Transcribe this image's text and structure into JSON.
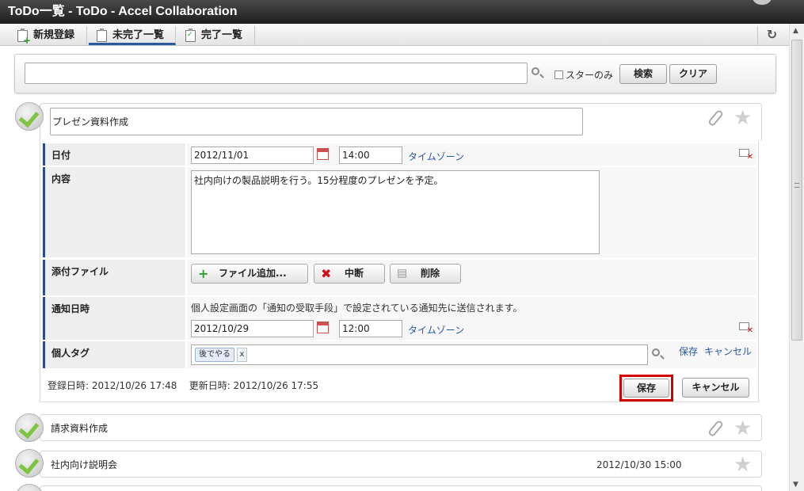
{
  "window": {
    "title": "ToDo一覧 - ToDo - Accel Collaboration"
  },
  "tabs": [
    {
      "label": "新規登録"
    },
    {
      "label": "未完了一覧",
      "active": true
    },
    {
      "label": "完了一覧"
    }
  ],
  "search": {
    "placeholder": "",
    "star_only_label": "スターのみ",
    "search_button": "検索",
    "clear_button": "クリア"
  },
  "todo_edit": {
    "title_value": "プレゼン資料作成",
    "date": {
      "label": "日付",
      "date_value": "2012/11/01",
      "time_value": "14:00",
      "timezone_link": "タイムゾーン"
    },
    "content": {
      "label": "内容",
      "value": "社内向けの製品説明を行う。15分程度のプレゼンを予定。"
    },
    "attachments": {
      "label": "添付ファイル",
      "add_button": "ファイル追加...",
      "abort_button": "中断",
      "delete_button": "削除"
    },
    "notify": {
      "label": "通知日時",
      "description": "個人設定画面の「通知の受取手段」で設定されている通知先に送信されます。",
      "date_value": "2012/10/29",
      "time_value": "12:00",
      "timezone_link": "タイムゾーン"
    },
    "personal_tags": {
      "label": "個人タグ",
      "tag": "後でやる",
      "tag_remove": "x",
      "save_link": "保存",
      "cancel_link": "キャンセル"
    },
    "meta": {
      "created": "登録日時: 2012/10/26 17:48",
      "updated": "更新日時: 2012/10/26 17:55"
    },
    "save_button": "保存",
    "cancel_button": "キャンセル"
  },
  "todo_list": [
    {
      "title": "請求資料作成",
      "date": ""
    },
    {
      "title": "社内向け説明会",
      "date": "2012/10/30 15:00"
    }
  ],
  "colors": {
    "accent": "#2d4d8a",
    "highlight": "#d40000",
    "link": "#2857a4",
    "check": "#7dc441"
  }
}
